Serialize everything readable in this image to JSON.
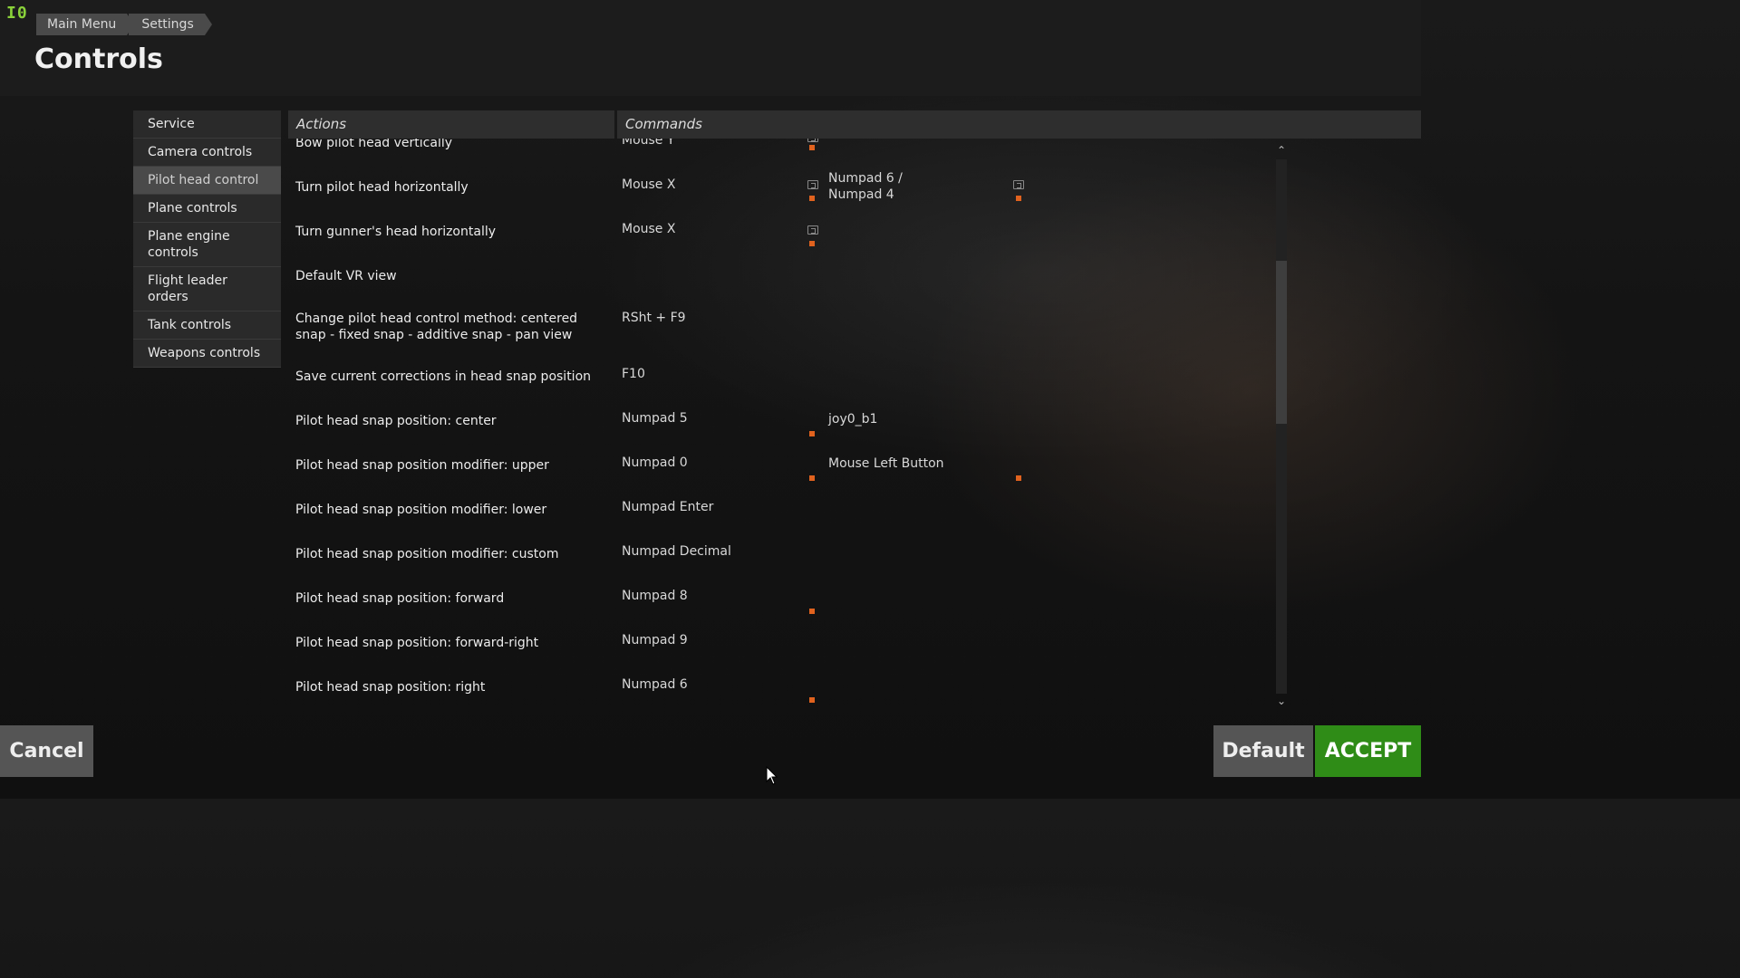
{
  "logo": "I0",
  "breadcrumb": [
    "Main Menu",
    "Settings"
  ],
  "page_title": "Controls",
  "sidebar": {
    "items": [
      {
        "label": "Service"
      },
      {
        "label": "Camera controls"
      },
      {
        "label": "Pilot head control"
      },
      {
        "label": "Plane controls"
      },
      {
        "label": "Plane engine controls"
      },
      {
        "label": "Flight leader orders"
      },
      {
        "label": "Tank controls"
      },
      {
        "label": "Weapons controls"
      }
    ],
    "active": "Pilot head control"
  },
  "table": {
    "headers": {
      "actions": "Actions",
      "commands": "Commands"
    },
    "rows": [
      {
        "action": "Bow pilot head vertically",
        "cmd1": "Mouse Y",
        "cmd2": ""
      },
      {
        "action": "Turn pilot head horizontally",
        "cmd1": "Mouse X",
        "cmd2": "Numpad 6 / Numpad 4"
      },
      {
        "action": "Turn gunner's head horizontally",
        "cmd1": "Mouse X",
        "cmd2": ""
      },
      {
        "action": "Default VR view",
        "cmd1": "",
        "cmd2": ""
      },
      {
        "action": "Change pilot head control method: centered snap - fixed snap - additive snap - pan view",
        "cmd1": "RSht + F9",
        "cmd2": ""
      },
      {
        "action": "Save current corrections in head snap position",
        "cmd1": "F10",
        "cmd2": ""
      },
      {
        "action": "Pilot head snap position: center",
        "cmd1": "Numpad 5",
        "cmd2": "joy0_b1"
      },
      {
        "action": "Pilot head snap position modifier: upper",
        "cmd1": "Numpad 0",
        "cmd2": "Mouse Left Button"
      },
      {
        "action": "Pilot head snap position modifier: lower",
        "cmd1": "Numpad Enter",
        "cmd2": ""
      },
      {
        "action": "Pilot head snap position modifier: custom",
        "cmd1": "Numpad Decimal",
        "cmd2": ""
      },
      {
        "action": "Pilot head snap position: forward",
        "cmd1": "Numpad 8",
        "cmd2": ""
      },
      {
        "action": "Pilot head snap position: forward-right",
        "cmd1": "Numpad 9",
        "cmd2": ""
      },
      {
        "action": "Pilot head snap position: right",
        "cmd1": "Numpad 6",
        "cmd2": ""
      }
    ]
  },
  "buttons": {
    "cancel": "Cancel",
    "default": "Default",
    "accept": "ACCEPT"
  },
  "colors": {
    "accent_green": "#2f8c17",
    "marker_orange": "#e0621e",
    "logo_green": "#8ad23a"
  },
  "scroll": {
    "up_icon": "⌃",
    "down_icon": "⌄"
  }
}
